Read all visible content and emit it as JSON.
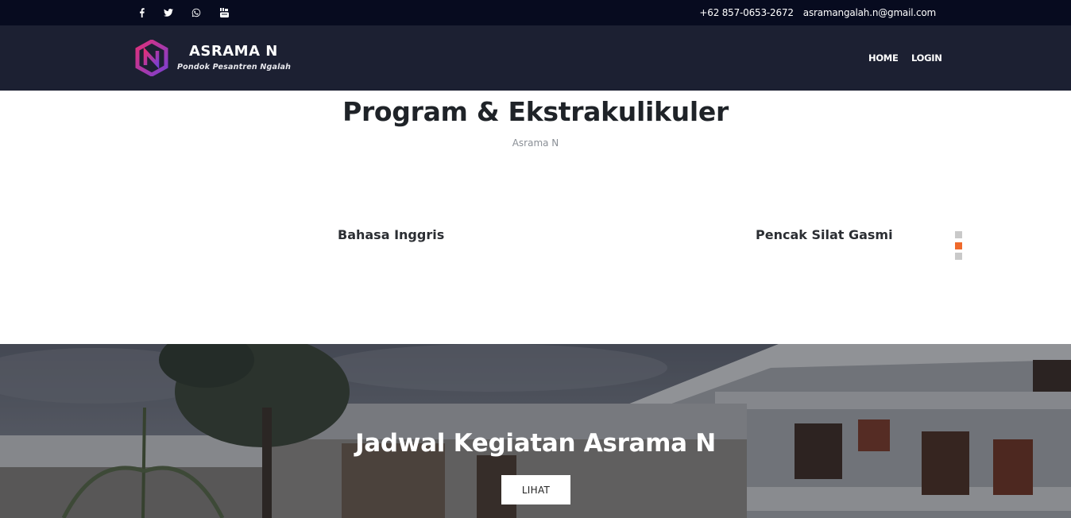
{
  "topbar": {
    "social": [
      {
        "icon": "facebook-icon",
        "glyph": "f"
      },
      {
        "icon": "twitter-icon",
        "glyph": "t"
      },
      {
        "icon": "whatsapp-icon",
        "glyph": "w"
      },
      {
        "icon": "youtube-icon",
        "glyph": "yt"
      }
    ],
    "phone": "+62 857-0653-2672",
    "email": "asramangalah.n@gmail.com"
  },
  "header": {
    "logo_title": "ASRAMA N",
    "logo_subtitle": "Pondok Pesantren Ngalah",
    "nav": [
      "HOME",
      "LOGIN"
    ]
  },
  "program": {
    "title": "Program & Ekstrakulikuler",
    "subtitle": "Asrama N",
    "items": [
      "Bahasa Inggris",
      "Pencak Silat Gasmi"
    ],
    "slider_dots": 3,
    "active_dot": 1
  },
  "hero": {
    "title": "Jadwal Kegiatan Asrama N",
    "button": "LIHAT"
  },
  "colors": {
    "topbar": "#070b1f",
    "header": "#1c2032",
    "accent": "#ef6a2c",
    "logo_gradient": [
      "#e0307a",
      "#7a3fd0"
    ]
  }
}
